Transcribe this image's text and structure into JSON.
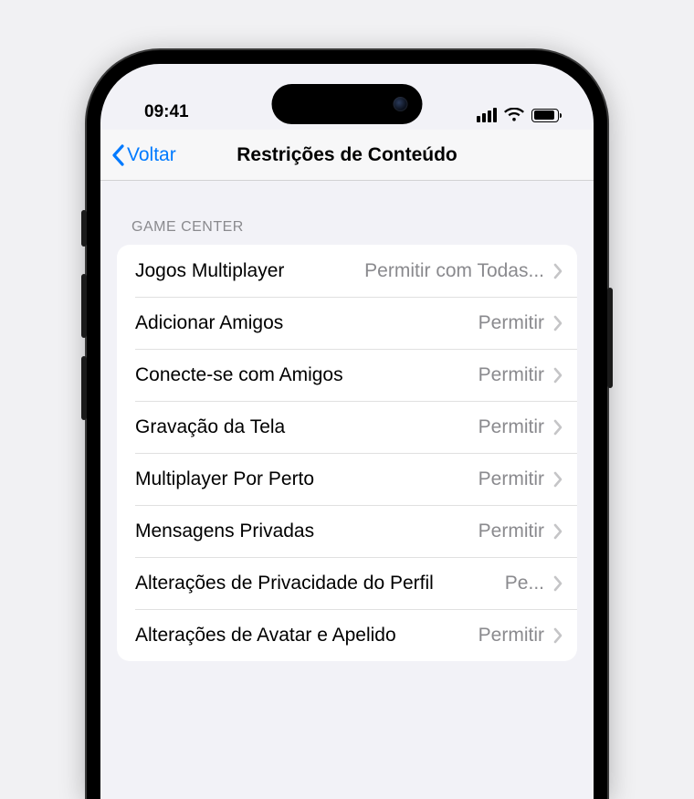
{
  "status": {
    "time": "09:41"
  },
  "nav": {
    "back_label": "Voltar",
    "title": "Restrições de Conteúdo"
  },
  "section": {
    "header": "GAME CENTER",
    "rows": [
      {
        "label": "Jogos Multiplayer",
        "value": "Permitir com Todas...",
        "narrow": false
      },
      {
        "label": "Adicionar Amigos",
        "value": "Permitir",
        "narrow": false
      },
      {
        "label": "Conecte-se com Amigos",
        "value": "Permitir",
        "narrow": false
      },
      {
        "label": "Gravação da Tela",
        "value": "Permitir",
        "narrow": false
      },
      {
        "label": "Multiplayer Por Perto",
        "value": "Permitir",
        "narrow": false
      },
      {
        "label": "Mensagens Privadas",
        "value": "Permitir",
        "narrow": false
      },
      {
        "label": "Alterações de Privacidade do Perfil",
        "value": "Pe...",
        "narrow": true
      },
      {
        "label": "Alterações de Avatar e Apelido",
        "value": "Permitir",
        "narrow": false
      }
    ]
  }
}
